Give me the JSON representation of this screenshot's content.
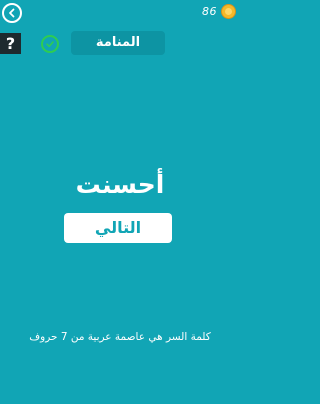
{
  "header": {
    "back_icon": "chevron-left-icon",
    "coins": "86",
    "coin_icon": "coin-icon"
  },
  "toolbar": {
    "help_label": "?",
    "check_icon": "check-circle-icon",
    "answer": "المنامة"
  },
  "result": {
    "message": "أحسنت",
    "next_label": "التالي"
  },
  "hint": {
    "text": "كلمة السر هي عاصمة عربية من 7 حروف"
  },
  "colors": {
    "background": "#11a5b5",
    "answer_box": "#0d94a3",
    "check": "#2ecc52",
    "coin": "#f5b92a"
  }
}
